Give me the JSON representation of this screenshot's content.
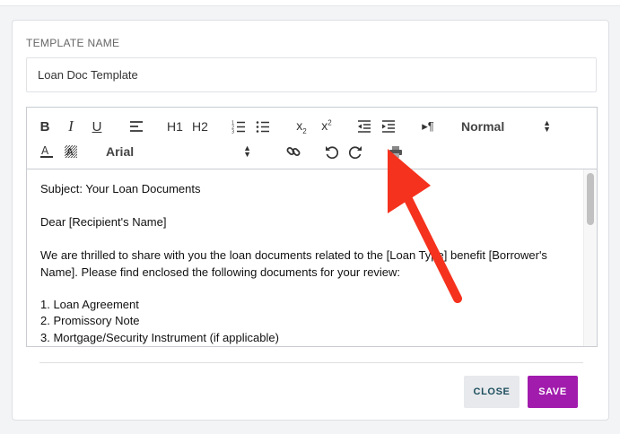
{
  "form": {
    "template_name_label": "TEMPLATE NAME",
    "template_name_value": "Loan Doc Template"
  },
  "toolbar": {
    "bold": "B",
    "italic": "I",
    "underline": "U",
    "h1": "H1",
    "h2": "H2",
    "format_select": "Normal",
    "font_select": "Arial"
  },
  "editor": {
    "lines": [
      "Subject: Your Loan Documents",
      "Dear [Recipient's Name]",
      "We are thrilled to share with you the loan documents related to the [Loan Type] benefit [Borrower's Name]. Please find enclosed the following documents for your review:",
      "1. Loan Agreement",
      "2. Promissory Note",
      "3. Mortgage/Security Instrument (if applicable)"
    ]
  },
  "actions": {
    "close_label": "CLOSE",
    "save_label": "SAVE"
  },
  "colors": {
    "save_bg": "#a11cad",
    "close_text": "#1f4f5f",
    "annotation_arrow": "#f5321e"
  },
  "icons": [
    "bold-icon",
    "italic-icon",
    "underline-icon",
    "align-icon",
    "ordered-list-icon",
    "bullet-list-icon",
    "subscript-icon",
    "superscript-icon",
    "outdent-icon",
    "indent-icon",
    "text-direction-icon",
    "text-color-icon",
    "background-color-icon",
    "link-icon",
    "undo-icon",
    "redo-icon",
    "print-icon"
  ]
}
